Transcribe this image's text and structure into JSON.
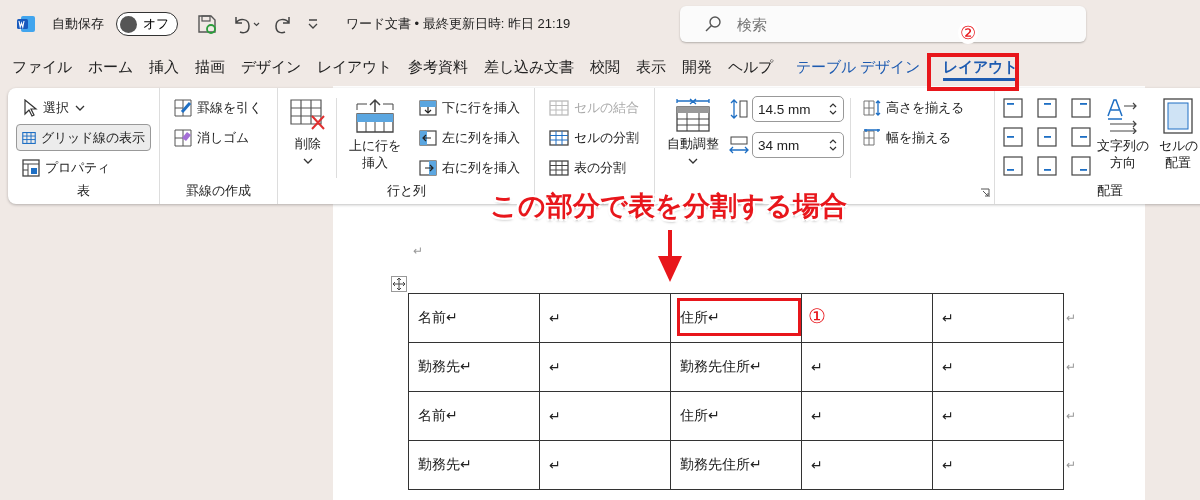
{
  "title_bar": {
    "autosave_label": "自動保存",
    "autosave": {
      "on": false,
      "label": "オフ"
    },
    "doc_title": "ワード文書 • 最終更新日時: 昨日 21:19",
    "search": {
      "placeholder": "検索"
    }
  },
  "tabs": [
    {
      "label": "ファイル",
      "selected": false,
      "kind": "normal"
    },
    {
      "label": "ホーム",
      "selected": false,
      "kind": "normal"
    },
    {
      "label": "挿入",
      "selected": false,
      "kind": "normal"
    },
    {
      "label": "描画",
      "selected": false,
      "kind": "normal"
    },
    {
      "label": "デザイン",
      "selected": false,
      "kind": "normal"
    },
    {
      "label": "レイアウト",
      "selected": false,
      "kind": "normal"
    },
    {
      "label": "参考資料",
      "selected": false,
      "kind": "normal"
    },
    {
      "label": "差し込み文書",
      "selected": false,
      "kind": "normal"
    },
    {
      "label": "校閲",
      "selected": false,
      "kind": "normal"
    },
    {
      "label": "表示",
      "selected": false,
      "kind": "normal"
    },
    {
      "label": "開発",
      "selected": false,
      "kind": "normal"
    },
    {
      "label": "ヘルプ",
      "selected": false,
      "kind": "normal"
    },
    {
      "label": "テーブル デザイン",
      "selected": false,
      "kind": "contextual"
    },
    {
      "label": "レイアウト",
      "selected": true,
      "kind": "contextual"
    }
  ],
  "ribbon": {
    "table_group": {
      "label": "表",
      "items": [
        {
          "label": "選択",
          "on": false
        },
        {
          "label": "グリッド線の表示",
          "on": true
        },
        {
          "label": "プロパティ",
          "on": false
        }
      ]
    },
    "draw_group": {
      "label": "罫線の作成",
      "items": [
        {
          "label": "罫線を引く"
        },
        {
          "label": "消しゴム"
        }
      ]
    },
    "rows_group": {
      "label": "行と列",
      "delete": "削除",
      "insert_above": "上に行を挿入",
      "items": [
        {
          "label": "下に行を挿入"
        },
        {
          "label": "左に列を挿入"
        },
        {
          "label": "右に列を挿入"
        }
      ]
    },
    "merge_group": {
      "items": [
        {
          "label": "セルの結合",
          "disabled": true
        },
        {
          "label": "セルの分割",
          "disabled": false
        },
        {
          "label": "表の分割",
          "disabled": false
        }
      ]
    },
    "size_group": {
      "autofit": "自動調整",
      "height": "14.5 mm",
      "width": "34 mm",
      "items": [
        {
          "label": "高さを揃える"
        },
        {
          "label": "幅を揃える"
        }
      ]
    },
    "align_group": {
      "label": "配置",
      "text_direction": "文字列の方向",
      "cell_margins": "セルの配置"
    }
  },
  "document": {
    "paragraph_mark": "↵",
    "rows": [
      {
        "cells": [
          "名前↵",
          "↵",
          "住所↵",
          null,
          "↵"
        ],
        "end_mark": "↵"
      },
      {
        "cells": [
          "勤務先↵",
          "↵",
          "勤務先住所↵",
          "↵",
          "↵"
        ],
        "end_mark": "↵"
      },
      {
        "cells": [
          "名前↵",
          "↵",
          "住所↵",
          "↵",
          "↵"
        ],
        "end_mark": "↵"
      },
      {
        "cells": [
          "勤務先↵",
          "↵",
          "勤務先住所↵",
          "↵",
          "↵"
        ],
        "end_mark": "↵"
      }
    ]
  },
  "annotations": {
    "callout": "この部分で表を分割する場合",
    "marker_1": "①",
    "marker_2": "②"
  }
}
